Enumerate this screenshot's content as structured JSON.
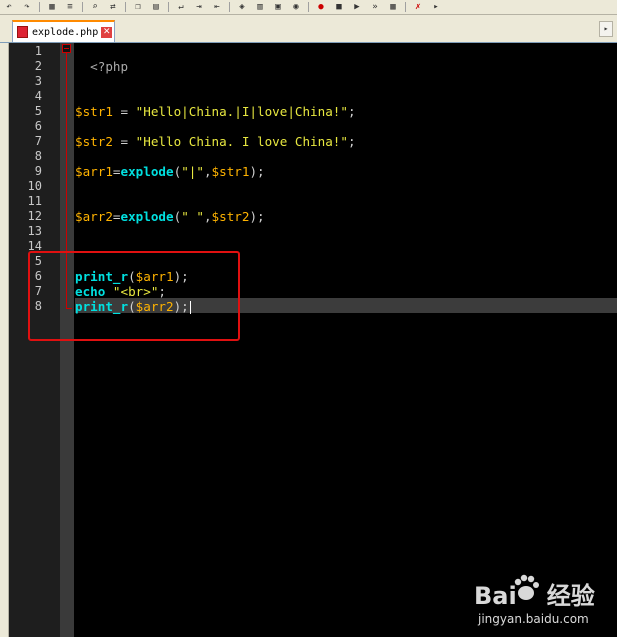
{
  "tab": {
    "filename": "explode.php",
    "close_glyph": "✕"
  },
  "toolbar": {
    "icons": [
      "undo-icon",
      "redo-icon",
      "grid-icon",
      "search-icon",
      "replace-icon",
      "cut-icon",
      "copy-icon",
      "paste-icon",
      "wrap-icon",
      "indent-icon",
      "outdent-icon",
      "bookmark-icon",
      "macro-icon",
      "record-icon",
      "play-icon",
      "stop-icon",
      "sync-icon",
      "view-icon",
      "close-icon"
    ]
  },
  "line_numbers": [
    "1",
    "2",
    "3",
    "4",
    "5",
    "6",
    "7",
    "8",
    "9",
    "10",
    "11",
    "12",
    "13",
    "14",
    "5",
    "6",
    "7",
    "8"
  ],
  "code": {
    "l1": {
      "tag": "<?php"
    },
    "l5": {
      "var": "$str1",
      "op": " = ",
      "str": "\"Hello|China.|I|love|China!\"",
      "end": ";"
    },
    "l7": {
      "var": "$str2",
      "op": " = ",
      "str": "\"Hello China. I love China!\"",
      "end": ";"
    },
    "l9": {
      "var": "$arr1",
      "op": "=",
      "fn": "explode",
      "open": "(",
      "str": "\"|\"",
      "comma": ",",
      "arg": "$str1",
      "close": ");"
    },
    "l12": {
      "var": "$arr2",
      "op": "=",
      "fn": "explode",
      "open": "(",
      "str": "\" \"",
      "comma": ",",
      "arg": "$str2",
      "close": ");"
    },
    "l16": {
      "fn": "print_r",
      "open": "(",
      "arg": "$arr1",
      "close": ");"
    },
    "l17": {
      "kw": "echo",
      "str": " \"<br>\"",
      "end": ";"
    },
    "l18": {
      "fn": "print_r",
      "open": "(",
      "arg": "$arr2",
      "close": ");"
    }
  },
  "watermark": {
    "logo_left": "Bai",
    "logo_right": "经验",
    "url": "jingyan.baidu.com"
  },
  "colors": {
    "highlight": "#e01010",
    "variable": "#ffb300",
    "string": "#e8e840",
    "function": "#00e0e0",
    "fold": "#cc0000"
  }
}
